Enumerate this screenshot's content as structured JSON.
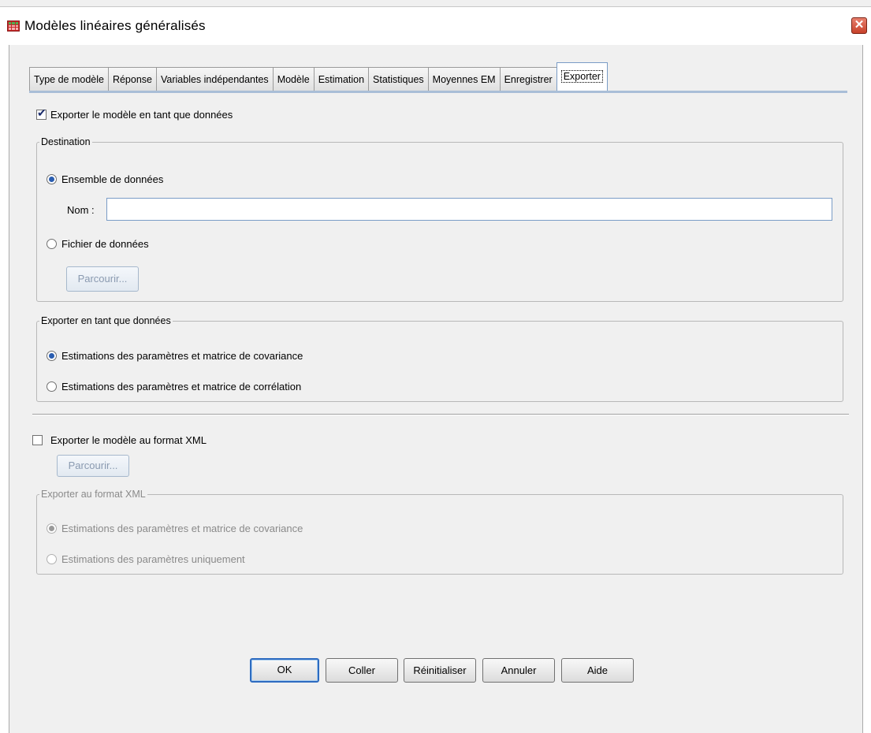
{
  "window": {
    "title": "Modèles linéaires généralisés",
    "close_label": "✕"
  },
  "tabs": [
    {
      "label": "Type de modèle"
    },
    {
      "label": "Réponse"
    },
    {
      "label": "Variables indépendantes"
    },
    {
      "label": "Modèle"
    },
    {
      "label": "Estimation"
    },
    {
      "label": "Statistiques"
    },
    {
      "label": "Moyennes EM"
    },
    {
      "label": "Enregistrer"
    },
    {
      "label": "Exporter",
      "active": true
    }
  ],
  "export_data": {
    "checkbox_label": "Exporter le modèle en tant que données",
    "checked": true,
    "destination": {
      "legend": "Destination",
      "dataset_label": "Ensemble de données",
      "dataset_selected": true,
      "name_label": "Nom :",
      "name_value": "",
      "file_label": "Fichier de données",
      "browse_label": "Parcourir..."
    },
    "as_data": {
      "legend": "Exporter en tant que données",
      "option_cov": "Estimations des paramètres et matrice de covariance",
      "option_corr": "Estimations des paramètres et matrice de corrélation",
      "selected": "cov"
    }
  },
  "export_xml": {
    "checkbox_label": "Exporter le modèle au format XML",
    "checked": false,
    "browse_label": "Parcourir...",
    "group": {
      "legend": "Exporter au format XML",
      "option_cov": "Estimations des paramètres et matrice de covariance",
      "option_params": "Estimations des paramètres uniquement",
      "selected": "cov"
    }
  },
  "buttons": {
    "ok": "OK",
    "paste": "Coller",
    "reset": "Réinitialiser",
    "cancel": "Annuler",
    "help": "Aide"
  }
}
